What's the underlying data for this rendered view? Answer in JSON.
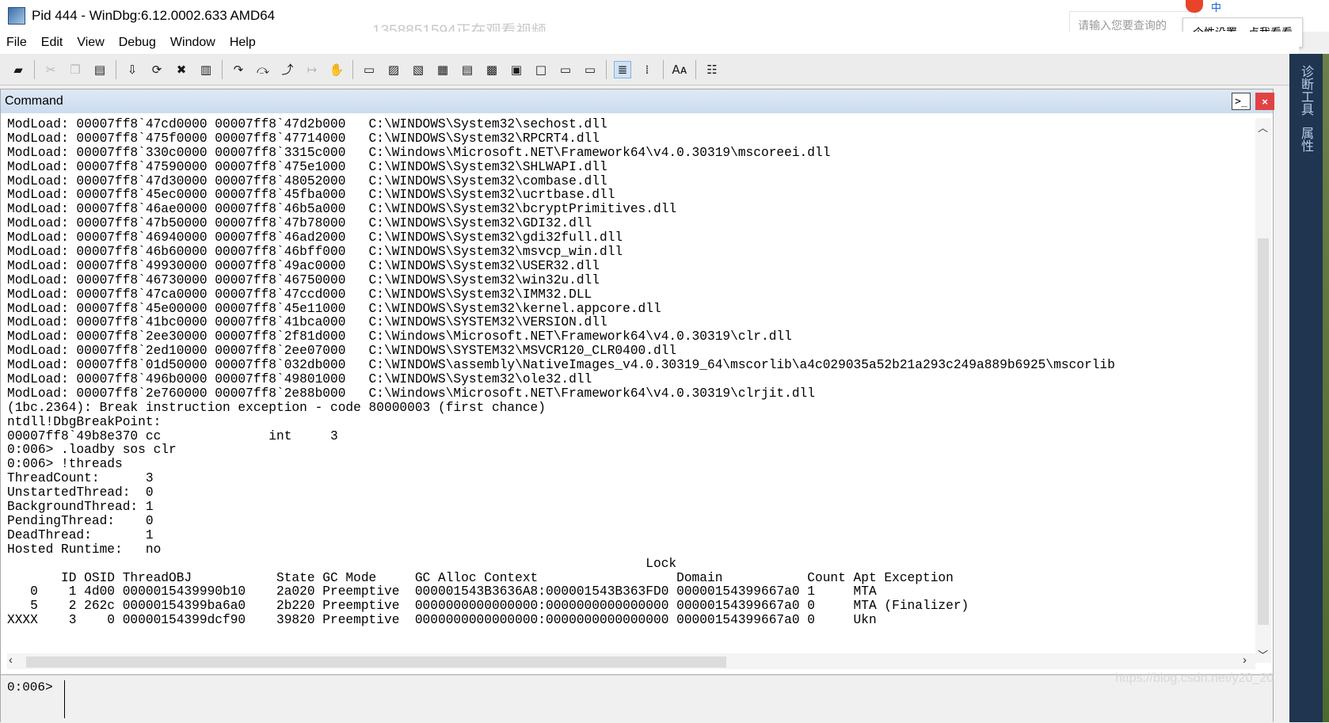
{
  "window": {
    "title": "Pid 444 - WinDbg:6.12.0002.633 AMD64",
    "overlay_watermark": "1358851594正在观看视频"
  },
  "overlay": {
    "search_placeholder": "请输入您要查询的",
    "tooltip": "个性设置，点我看看",
    "ime_mode": "中"
  },
  "menu": [
    "File",
    "Edit",
    "View",
    "Debug",
    "Window",
    "Help"
  ],
  "toolbar_icons": [
    {
      "name": "open-icon",
      "glyph": "▰",
      "enabled": true
    },
    {
      "name": "cut-icon",
      "glyph": "✂",
      "enabled": false
    },
    {
      "name": "copy-icon",
      "glyph": "❐",
      "enabled": false
    },
    {
      "name": "paste-icon",
      "glyph": "▤",
      "enabled": true
    },
    {
      "name": "go-icon",
      "glyph": "⇩",
      "enabled": true
    },
    {
      "name": "restart-icon",
      "glyph": "⟳",
      "enabled": true
    },
    {
      "name": "stop-debugging-icon",
      "glyph": "✖",
      "enabled": true
    },
    {
      "name": "break-icon",
      "glyph": "▥",
      "enabled": true
    },
    {
      "name": "step-into-icon",
      "glyph": "↷",
      "enabled": true
    },
    {
      "name": "step-over-icon",
      "glyph": "⤼",
      "enabled": true
    },
    {
      "name": "step-out-icon",
      "glyph": "⤴",
      "enabled": true
    },
    {
      "name": "run-to-cursor-icon",
      "glyph": "↦",
      "enabled": false
    },
    {
      "name": "breakpoint-hand-icon",
      "glyph": "✋",
      "enabled": true
    },
    {
      "name": "command-window-icon",
      "glyph": "▭",
      "enabled": true
    },
    {
      "name": "watch-window-icon",
      "glyph": "▨",
      "enabled": true
    },
    {
      "name": "locals-window-icon",
      "glyph": "▧",
      "enabled": true
    },
    {
      "name": "registers-window-icon",
      "glyph": "▦",
      "enabled": true
    },
    {
      "name": "memory-window-icon",
      "glyph": "▤",
      "enabled": true
    },
    {
      "name": "call-stack-window-icon",
      "glyph": "▩",
      "enabled": true
    },
    {
      "name": "disassembly-window-icon",
      "glyph": "▣",
      "enabled": true
    },
    {
      "name": "scratch-pad-icon",
      "glyph": "□",
      "enabled": true
    },
    {
      "name": "processes-threads-icon",
      "glyph": "▭",
      "enabled": true
    },
    {
      "name": "source-mode-icon",
      "glyph": "▭",
      "enabled": true
    },
    {
      "name": "source-mode-toggle-icon",
      "glyph": "≣",
      "enabled": true,
      "active": true
    },
    {
      "name": "hex-display-icon",
      "glyph": "⁞",
      "enabled": true
    },
    {
      "name": "font-icon",
      "glyph": "Aᴀ",
      "enabled": true
    },
    {
      "name": "options-icon",
      "glyph": "☷",
      "enabled": true
    }
  ],
  "right_panel": {
    "labels": [
      "诊断工具",
      "属性"
    ]
  },
  "command_window": {
    "title": "Command",
    "lines": [
      "ModLoad: 00007ff8`47cd0000 00007ff8`47d2b000   C:\\WINDOWS\\System32\\sechost.dll",
      "ModLoad: 00007ff8`475f0000 00007ff8`47714000   C:\\WINDOWS\\System32\\RPCRT4.dll",
      "ModLoad: 00007ff8`330c0000 00007ff8`3315c000   C:\\Windows\\Microsoft.NET\\Framework64\\v4.0.30319\\mscoreei.dll",
      "ModLoad: 00007ff8`47590000 00007ff8`475e1000   C:\\WINDOWS\\System32\\SHLWAPI.dll",
      "ModLoad: 00007ff8`47d30000 00007ff8`48052000   C:\\WINDOWS\\System32\\combase.dll",
      "ModLoad: 00007ff8`45ec0000 00007ff8`45fba000   C:\\WINDOWS\\System32\\ucrtbase.dll",
      "ModLoad: 00007ff8`46ae0000 00007ff8`46b5a000   C:\\WINDOWS\\System32\\bcryptPrimitives.dll",
      "ModLoad: 00007ff8`47b50000 00007ff8`47b78000   C:\\WINDOWS\\System32\\GDI32.dll",
      "ModLoad: 00007ff8`46940000 00007ff8`46ad2000   C:\\WINDOWS\\System32\\gdi32full.dll",
      "ModLoad: 00007ff8`46b60000 00007ff8`46bff000   C:\\WINDOWS\\System32\\msvcp_win.dll",
      "ModLoad: 00007ff8`49930000 00007ff8`49ac0000   C:\\WINDOWS\\System32\\USER32.dll",
      "ModLoad: 00007ff8`46730000 00007ff8`46750000   C:\\WINDOWS\\System32\\win32u.dll",
      "ModLoad: 00007ff8`47ca0000 00007ff8`47ccd000   C:\\WINDOWS\\System32\\IMM32.DLL",
      "ModLoad: 00007ff8`45e00000 00007ff8`45e11000   C:\\WINDOWS\\System32\\kernel.appcore.dll",
      "ModLoad: 00007ff8`41bc0000 00007ff8`41bca000   C:\\WINDOWS\\SYSTEM32\\VERSION.dll",
      "ModLoad: 00007ff8`2ee30000 00007ff8`2f81d000   C:\\Windows\\Microsoft.NET\\Framework64\\v4.0.30319\\clr.dll",
      "ModLoad: 00007ff8`2ed10000 00007ff8`2ee07000   C:\\WINDOWS\\SYSTEM32\\MSVCR120_CLR0400.dll",
      "ModLoad: 00007ff8`01d50000 00007ff8`032db000   C:\\WINDOWS\\assembly\\NativeImages_v4.0.30319_64\\mscorlib\\a4c029035a52b21a293c249a889b6925\\mscorlib",
      "ModLoad: 00007ff8`496b0000 00007ff8`49801000   C:\\WINDOWS\\System32\\ole32.dll",
      "ModLoad: 00007ff8`2e760000 00007ff8`2e88b000   C:\\Windows\\Microsoft.NET\\Framework64\\v4.0.30319\\clrjit.dll",
      "(1bc.2364): Break instruction exception - code 80000003 (first chance)",
      "ntdll!DbgBreakPoint:",
      "00007ff8`49b8e370 cc              int     3",
      "0:006> .loadby sos clr",
      "0:006> !threads",
      "ThreadCount:      3",
      "UnstartedThread:  0",
      "BackgroundThread: 1",
      "PendingThread:    0",
      "DeadThread:       1",
      "Hosted Runtime:   no",
      "                                                                                   Lock",
      "       ID OSID ThreadOBJ           State GC Mode     GC Alloc Context                  Domain           Count Apt Exception",
      "   0    1 4d00 0000015439990b10    2a020 Preemptive  000001543B3636A8:000001543B363FD0 00000154399667a0 1     MTA",
      "   5    2 262c 00000154399ba6a0    2b220 Preemptive  0000000000000000:0000000000000000 00000154399667a0 0     MTA (Finalizer)",
      "XXXX    3    0 00000154399dcf90    39820 Preemptive  0000000000000000:0000000000000000 00000154399667a0 0     Ukn"
    ],
    "prompt": "0:006>",
    "input_value": ""
  },
  "bottom_watermark": "https://blog.csdn.net/y20_20"
}
